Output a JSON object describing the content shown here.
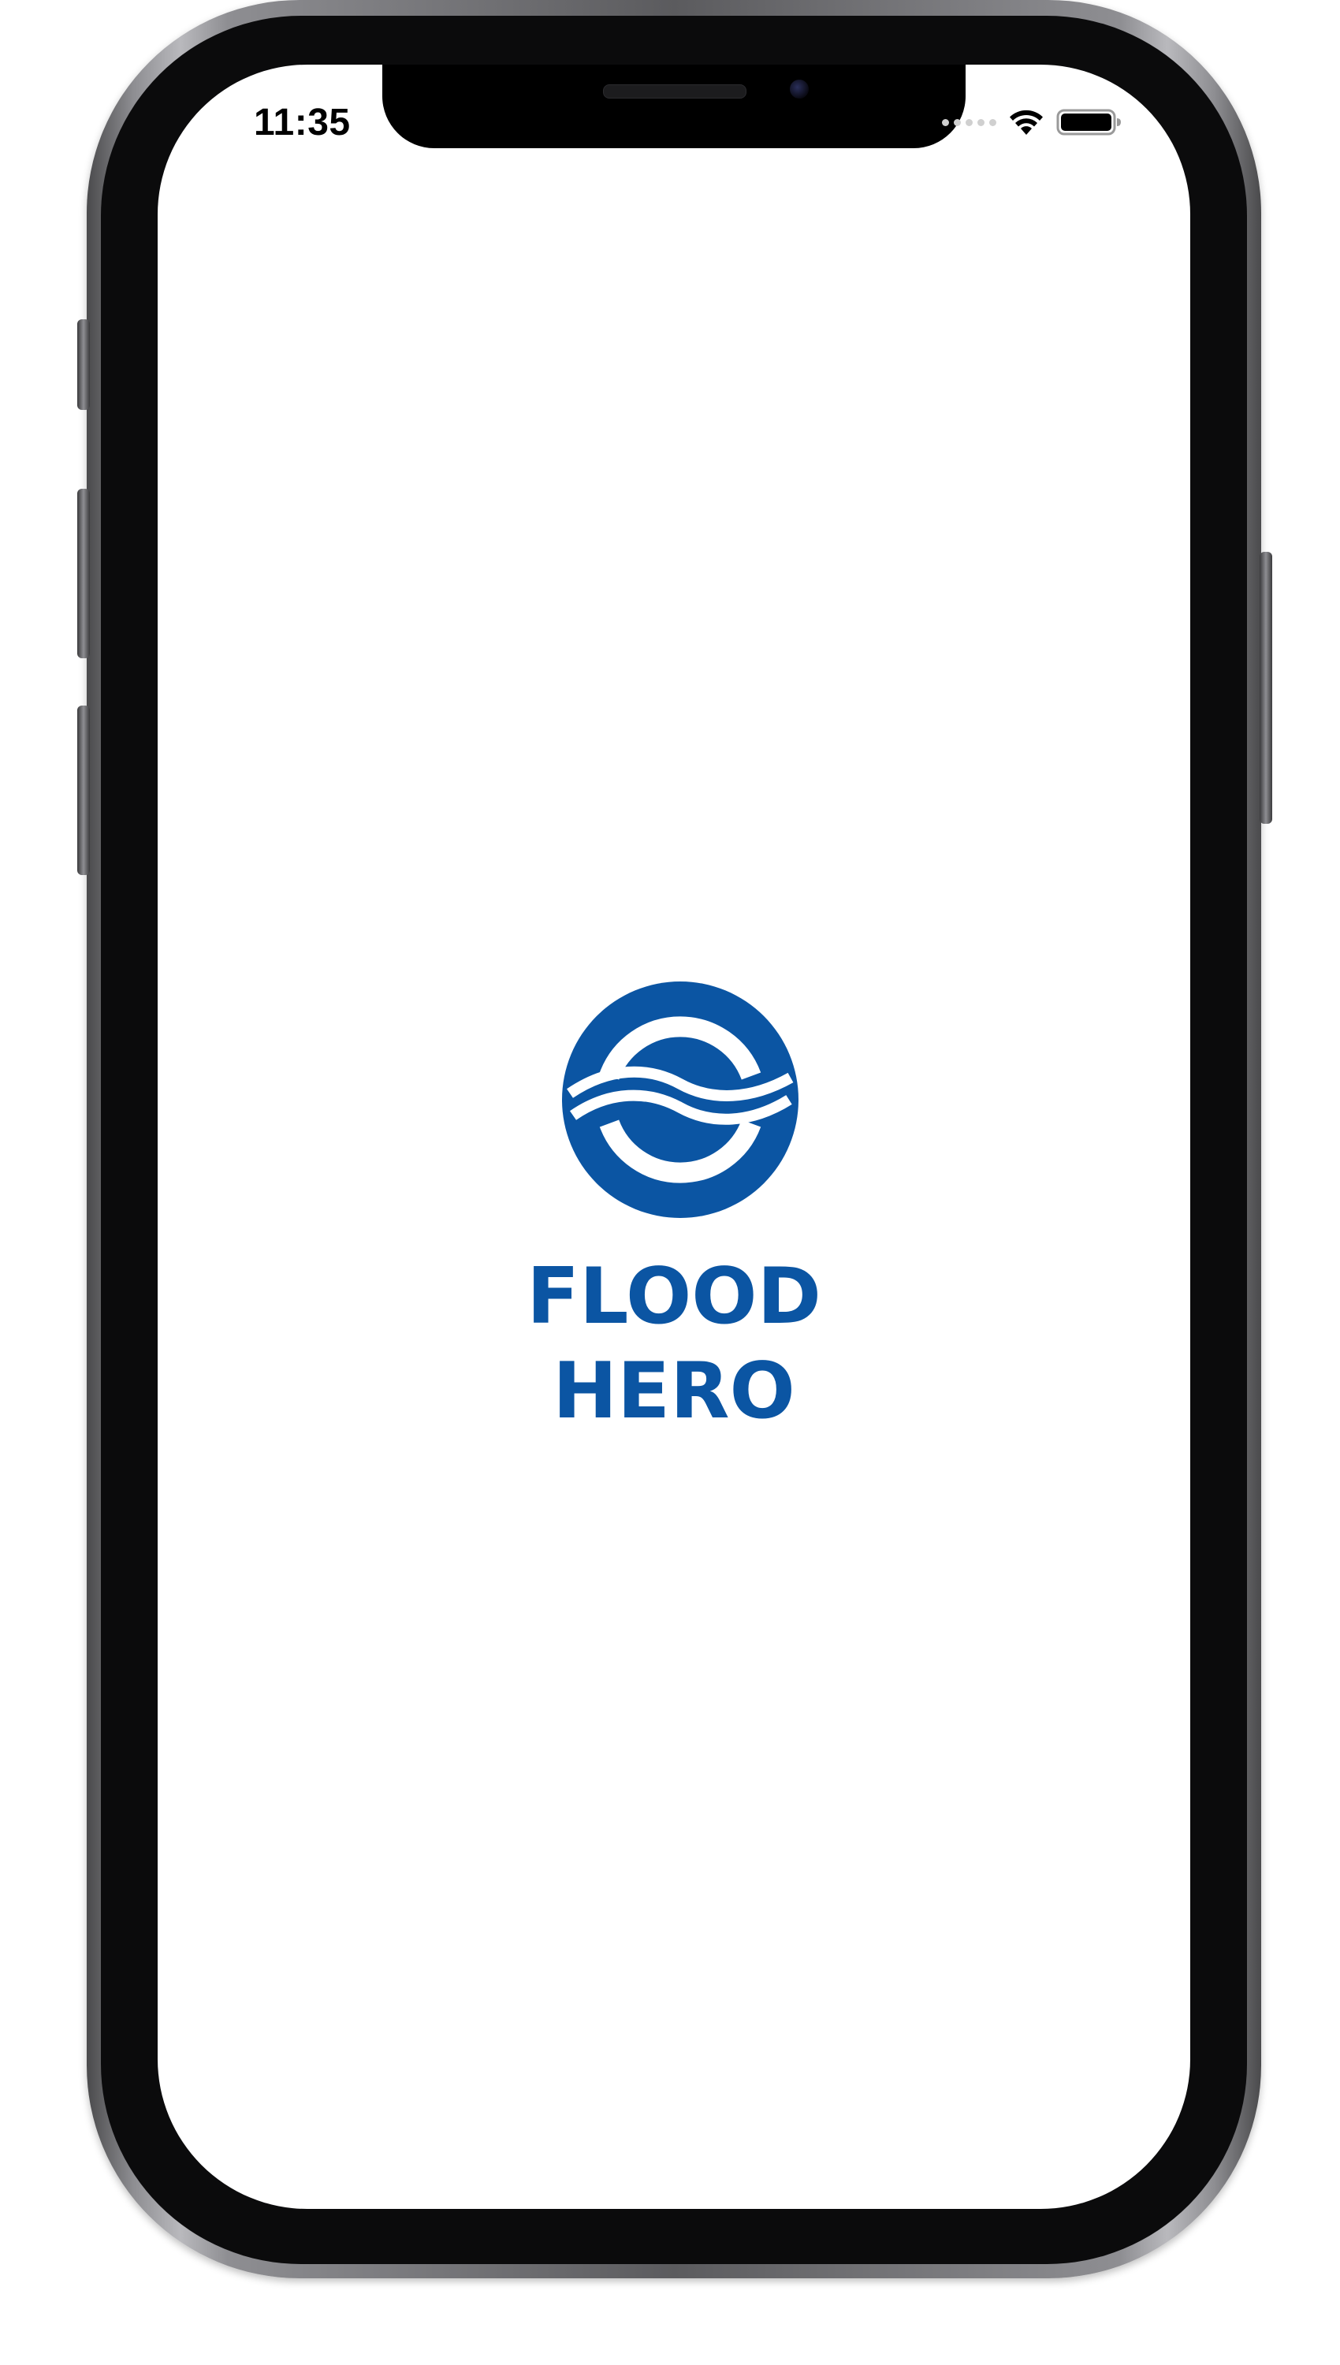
{
  "status_bar": {
    "time": "11:35",
    "wifi_icon": "wifi-icon",
    "battery_icon": "battery-full-icon",
    "signal_icon": "cellular-signal-dots-icon"
  },
  "splash": {
    "app_name": "FLOOD HERO",
    "logo_icon": "flood-hero-wave-circle-logo",
    "brand_color": "#0b55a3",
    "background_color": "#ffffff"
  },
  "device": {
    "frame_icon": "iphone-x-frame"
  }
}
